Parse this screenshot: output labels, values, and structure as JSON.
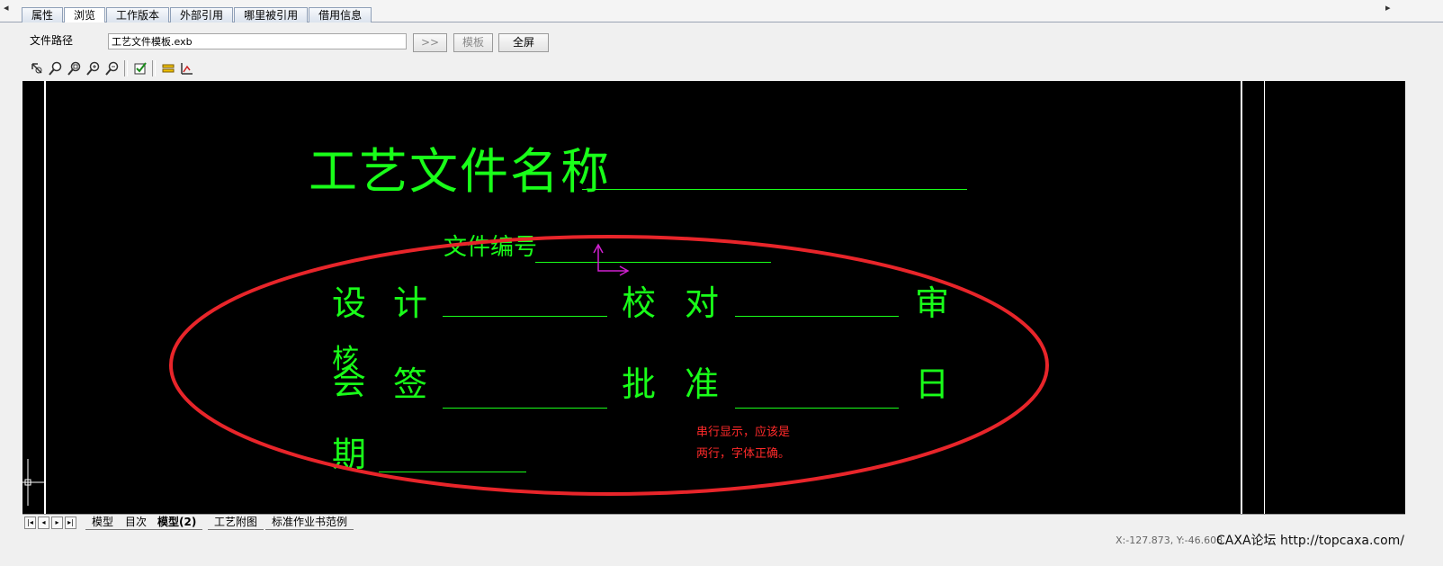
{
  "tabs": [
    "属性",
    "浏览",
    "工作版本",
    "外部引用",
    "哪里被引用",
    "借用信息"
  ],
  "active_tab": "浏览",
  "file_path": {
    "label": "文件路径",
    "value": "工艺文件模板.exb"
  },
  "buttons": {
    "browse": ">>",
    "template": "模板",
    "fullscreen": "全屏"
  },
  "toolbar_icons": [
    "pan-icon",
    "zoom-icon",
    "zoom-window-icon",
    "zoom-in-icon",
    "zoom-previous-icon",
    "check-icon",
    "layer-icon",
    "measure-icon"
  ],
  "drawing": {
    "title": "工艺文件名称",
    "doc_number": "文件编号",
    "row1": [
      "设",
      "计",
      "校",
      "对",
      "审"
    ],
    "row2": [
      "核",
      "会",
      "签",
      "批",
      "准",
      "日"
    ],
    "row3": "期",
    "line_color": "#19ff19"
  },
  "annotation": {
    "line1": "串行显示，应该是",
    "line2": "两行，字体正确。",
    "color": "#ff2a2a"
  },
  "sheet_tabs": [
    "模型",
    "目次",
    "模型(2)",
    "工艺附图",
    "标准作业书范例"
  ],
  "active_sheet": "模型(2)",
  "status": {
    "coords": "X:-127.873, Y:-46.608"
  },
  "watermark": "CAXA论坛 http://topcaxa.com/"
}
